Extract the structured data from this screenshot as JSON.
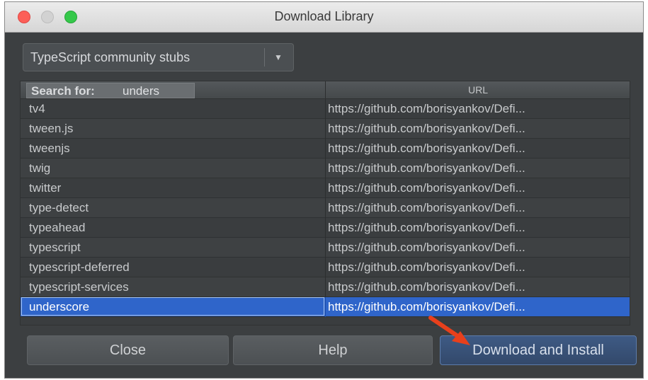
{
  "window": {
    "title": "Download Library"
  },
  "repository_select": {
    "selected": "TypeScript community stubs"
  },
  "search": {
    "label": "Search for:",
    "query": "unders"
  },
  "table": {
    "url_header": "URL",
    "rows": [
      {
        "name": "tv4",
        "url": "https://github.com/borisyankov/Defi..."
      },
      {
        "name": "tween.js",
        "url": "https://github.com/borisyankov/Defi..."
      },
      {
        "name": "tweenjs",
        "url": "https://github.com/borisyankov/Defi..."
      },
      {
        "name": "twig",
        "url": "https://github.com/borisyankov/Defi..."
      },
      {
        "name": "twitter",
        "url": "https://github.com/borisyankov/Defi..."
      },
      {
        "name": "type-detect",
        "url": "https://github.com/borisyankov/Defi..."
      },
      {
        "name": "typeahead",
        "url": "https://github.com/borisyankov/Defi..."
      },
      {
        "name": "typescript",
        "url": "https://github.com/borisyankov/Defi..."
      },
      {
        "name": "typescript-deferred",
        "url": "https://github.com/borisyankov/Defi..."
      },
      {
        "name": "typescript-services",
        "url": "https://github.com/borisyankov/Defi..."
      },
      {
        "name": "underscore",
        "url": "https://github.com/borisyankov/Defi...",
        "selected": true
      }
    ]
  },
  "buttons": {
    "close": "Close",
    "help": "Help",
    "download_install": "Download and Install"
  },
  "colors": {
    "selection": "#2f65ca",
    "annotation_arrow": "#e8401c"
  }
}
